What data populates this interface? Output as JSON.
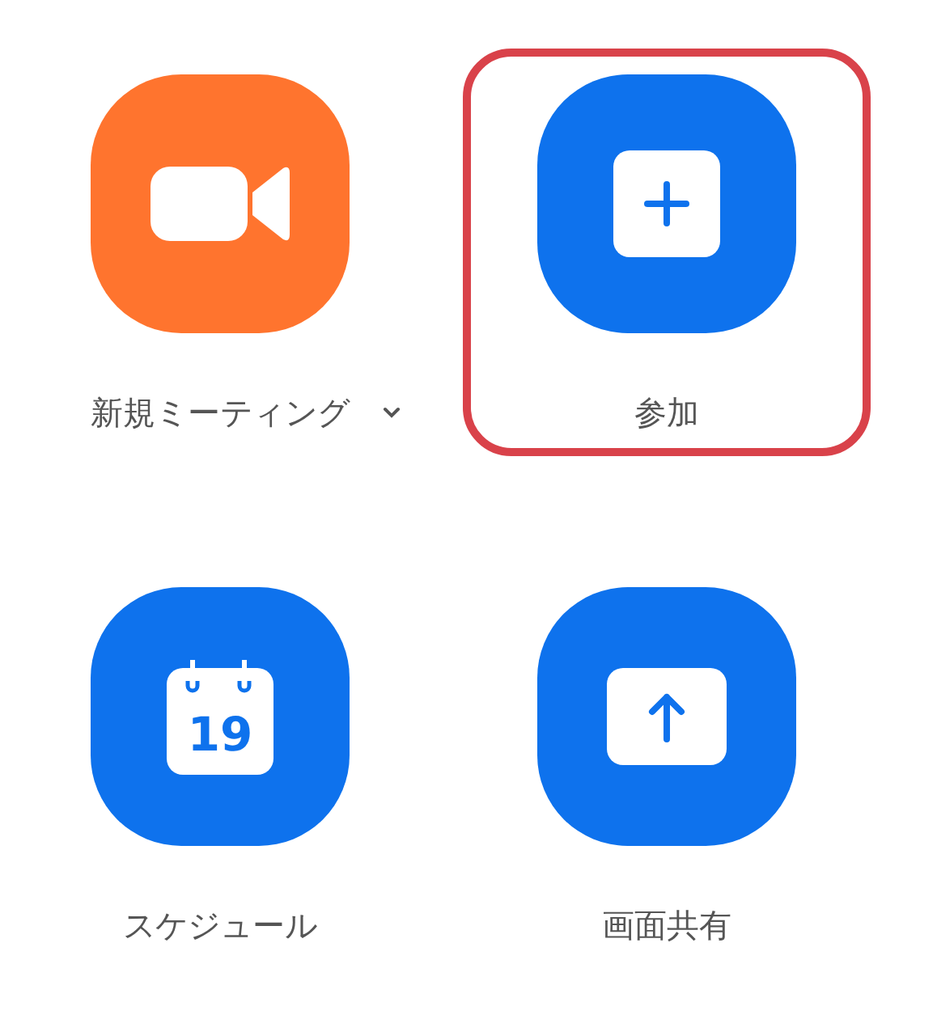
{
  "actions": [
    {
      "kind": "video",
      "label": "新規ミーティング",
      "has_dropdown": true,
      "highlighted": false,
      "color": "#ff742e"
    },
    {
      "kind": "join",
      "label": "参加",
      "has_dropdown": false,
      "highlighted": true,
      "color": "#0e72ed"
    },
    {
      "kind": "calendar",
      "label": "スケジュール",
      "has_dropdown": false,
      "highlighted": false,
      "color": "#0e72ed",
      "date": "19"
    },
    {
      "kind": "share",
      "label": "画面共有",
      "has_dropdown": false,
      "highlighted": false,
      "color": "#0e72ed"
    }
  ]
}
